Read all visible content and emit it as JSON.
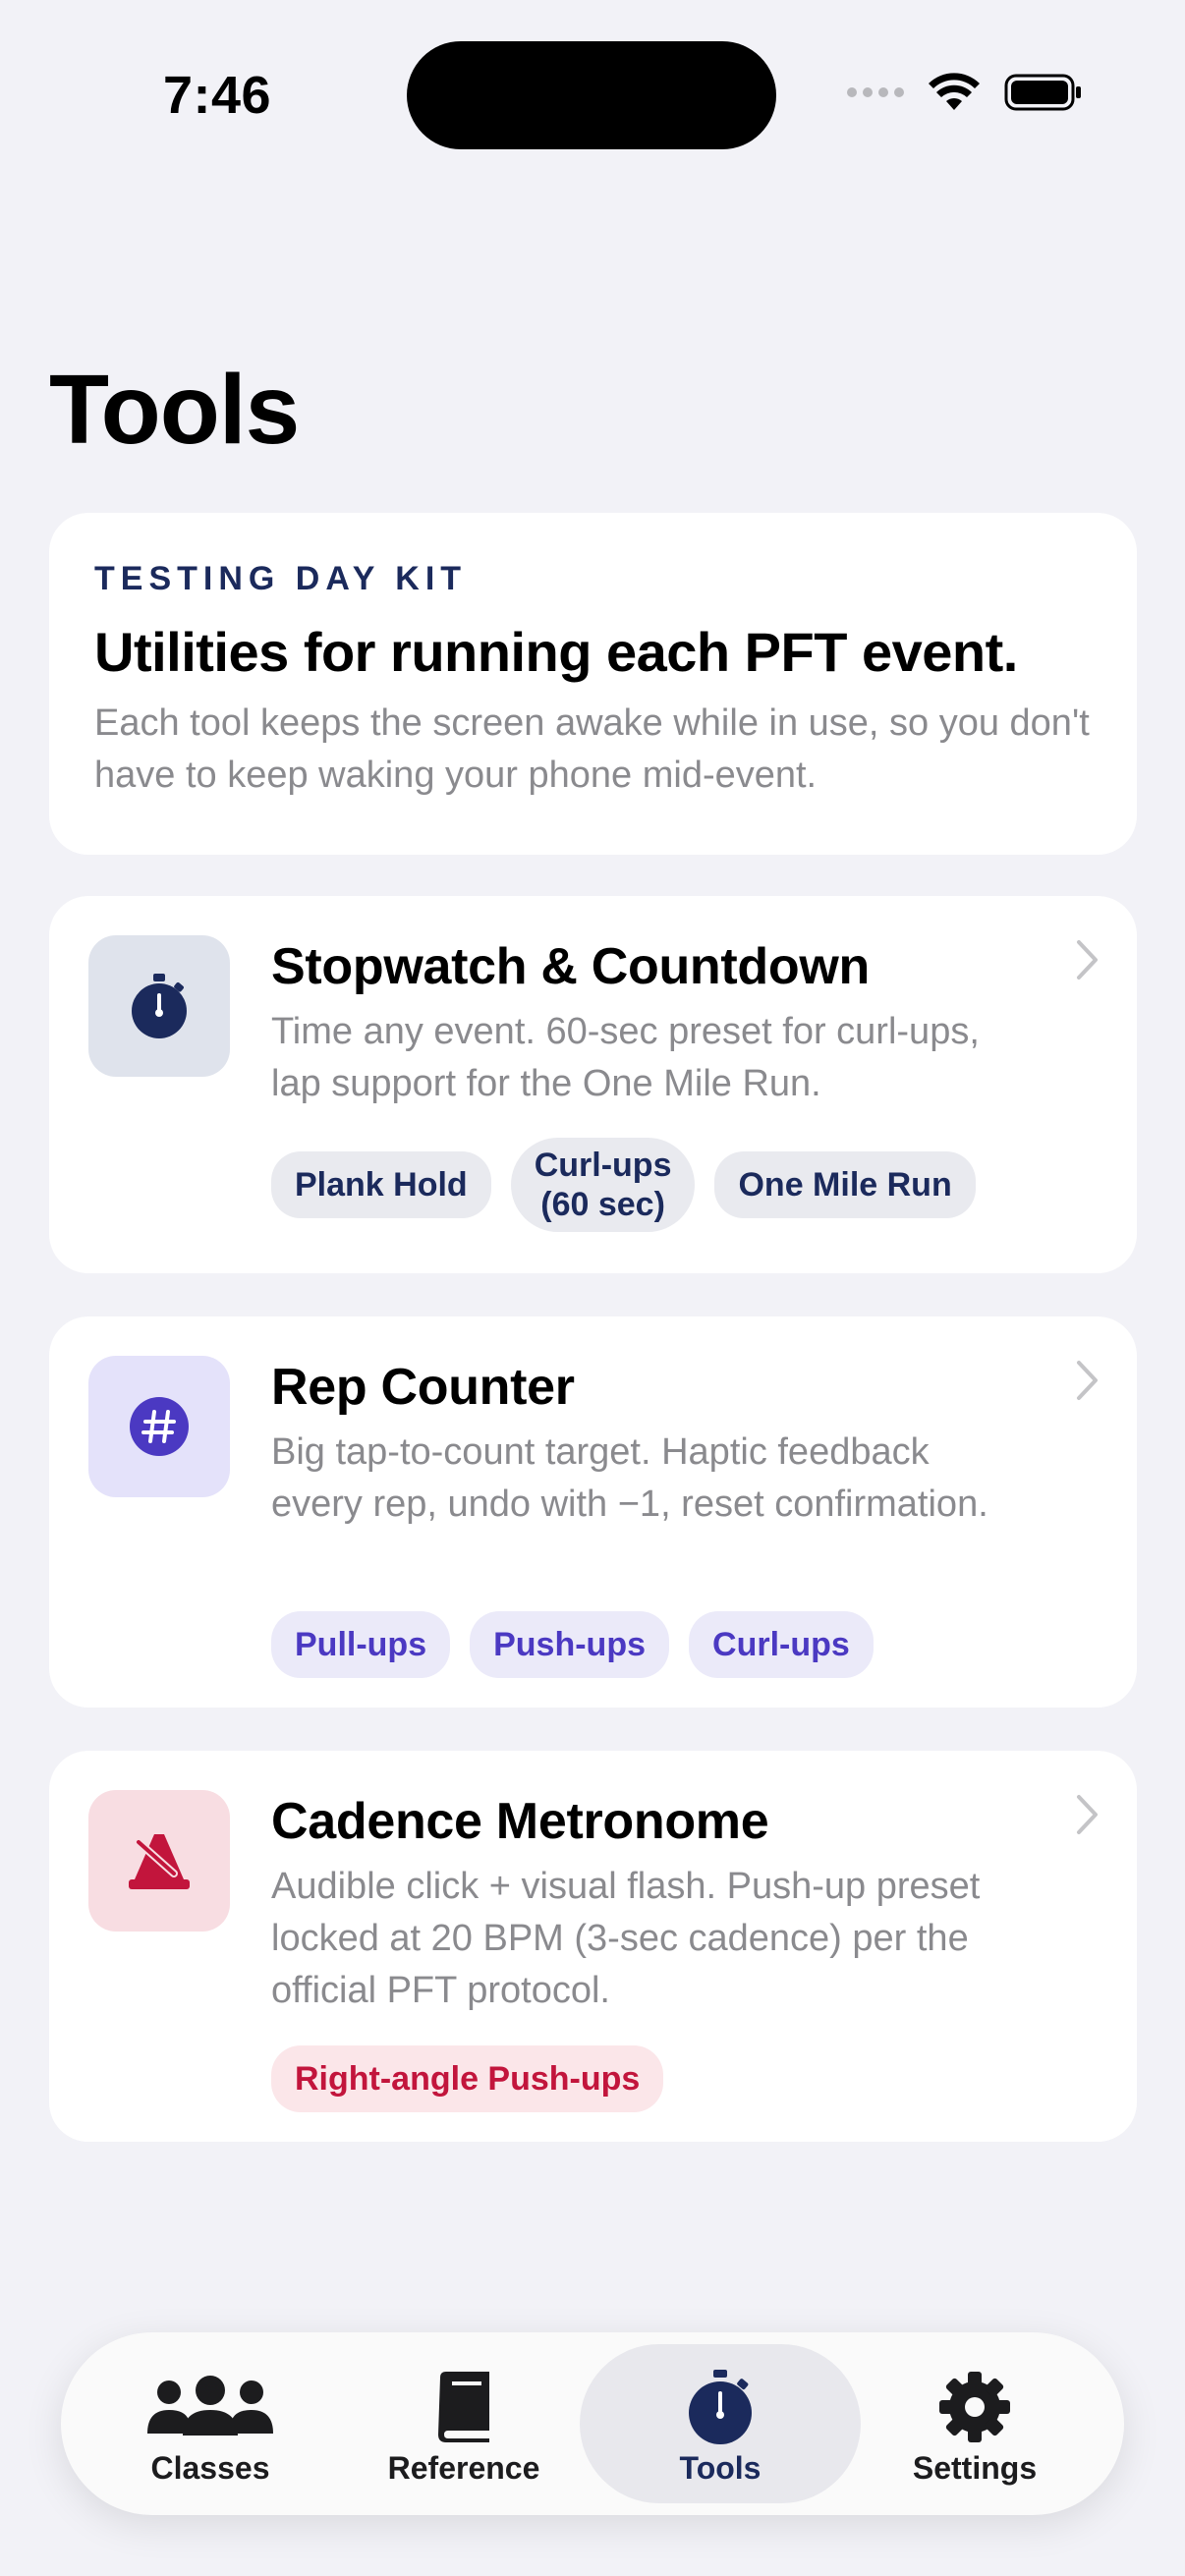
{
  "status_bar": {
    "time": "7:46"
  },
  "page": {
    "title": "Tools"
  },
  "intro": {
    "eyebrow": "TESTING DAY KIT",
    "heading": "Utilities for running each PFT event.",
    "body": "Each tool keeps the screen awake while in use, so you don't have to keep waking your phone mid-event."
  },
  "tools": [
    {
      "title": "Stopwatch & Countdown",
      "description": "Time any event. 60-sec preset for curl-ups, lap support for the One Mile Run.",
      "icon": "stopwatch-icon",
      "accent": "#1b2a5c",
      "chips": [
        "Plank Hold",
        "Curl-ups\n(60 sec)",
        "One Mile Run"
      ]
    },
    {
      "title": "Rep Counter",
      "description": "Big tap-to-count target. Haptic feedback every rep, undo with −1, reset confirmation.",
      "icon": "number-icon",
      "accent": "#4b39c2",
      "chips": [
        "Pull-ups",
        "Push-ups",
        "Curl-ups"
      ]
    },
    {
      "title": "Cadence Metronome",
      "description": "Audible click + visual flash. Push-up preset locked at 20 BPM (3-sec cadence) per the official PFT protocol.",
      "icon": "metronome-icon",
      "accent": "#c2153c",
      "chips": [
        "Right-angle Push-ups"
      ]
    }
  ],
  "tab_bar": {
    "tabs": [
      {
        "label": "Classes",
        "icon": "people-icon"
      },
      {
        "label": "Reference",
        "icon": "book-icon"
      },
      {
        "label": "Tools",
        "icon": "stopwatch-icon",
        "active": true
      },
      {
        "label": "Settings",
        "icon": "gear-icon"
      }
    ]
  }
}
